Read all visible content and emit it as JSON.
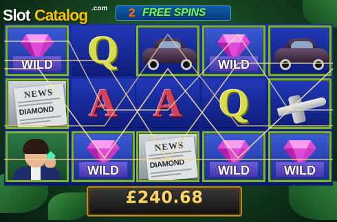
{
  "watermark": {
    "part1": "Slot",
    "part2": "Catalog",
    "suffix": ".com"
  },
  "header": {
    "free_spins_count": "2",
    "free_spins_label": "FREE SPINS"
  },
  "reels": {
    "rows": [
      [
        {
          "symbol": "wild",
          "label": "WILD"
        },
        {
          "symbol": "Q",
          "label": "Q"
        },
        {
          "symbol": "car",
          "label": ""
        },
        {
          "symbol": "wild",
          "label": "WILD"
        },
        {
          "symbol": "car",
          "label": ""
        }
      ],
      [
        {
          "symbol": "newspaper",
          "label": "NEWS"
        },
        {
          "symbol": "A",
          "label": "A"
        },
        {
          "symbol": "A",
          "label": "A"
        },
        {
          "symbol": "Q",
          "label": "Q"
        },
        {
          "symbol": "plane",
          "label": ""
        }
      ],
      [
        {
          "symbol": "man",
          "label": ""
        },
        {
          "symbol": "wild",
          "label": "WILD"
        },
        {
          "symbol": "newspaper",
          "label": "NEWS"
        },
        {
          "symbol": "wild",
          "label": "WILD"
        },
        {
          "symbol": "wild",
          "label": "WILD"
        }
      ]
    ],
    "newspaper_headline": "DIAMOND"
  },
  "win": {
    "amount": "£240.68"
  },
  "colors": {
    "banner": "#0f5fae",
    "free_count": "#ff7a1a",
    "free_label": "#7cf06a",
    "frame": "#7fb03a",
    "win_text": "#f6d66a"
  }
}
